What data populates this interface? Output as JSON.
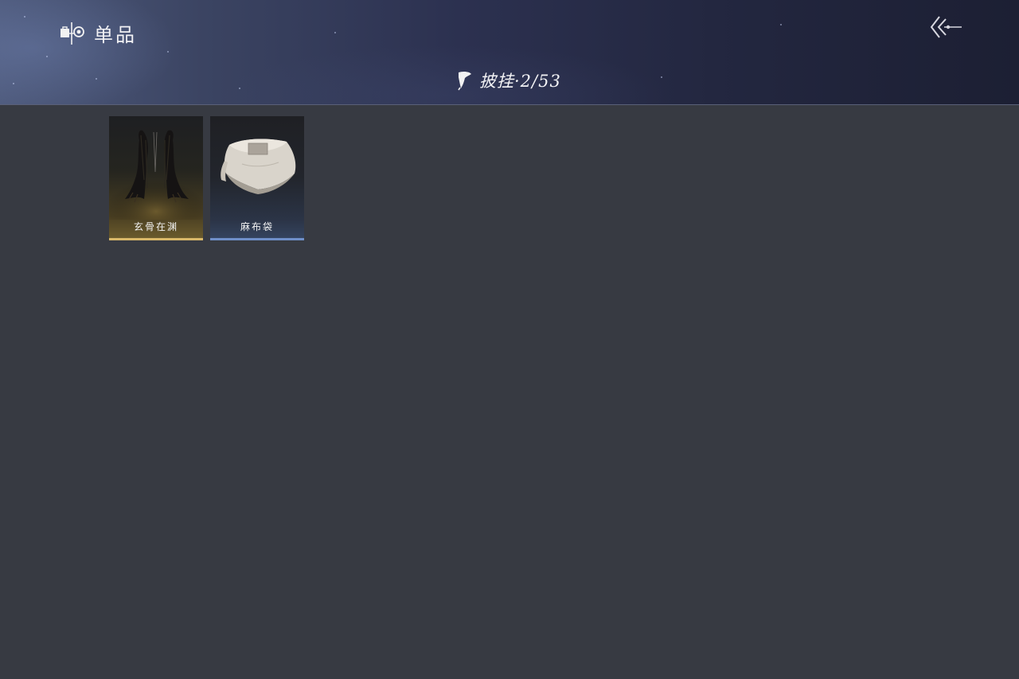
{
  "header": {
    "title": "单品",
    "title_icon": "wardrobe-eye-icon",
    "back_icon": "double-chevron-back-icon"
  },
  "category": {
    "icon": "cape-icon",
    "title": "披挂·2/53"
  },
  "items": [
    {
      "name": "玄骨在渊",
      "rarity_color": "#d9b869",
      "icon": "dark-feather-cape-icon"
    },
    {
      "name": "麻布袋",
      "rarity_color": "#6f8fc8",
      "icon": "linen-sack-icon"
    }
  ]
}
